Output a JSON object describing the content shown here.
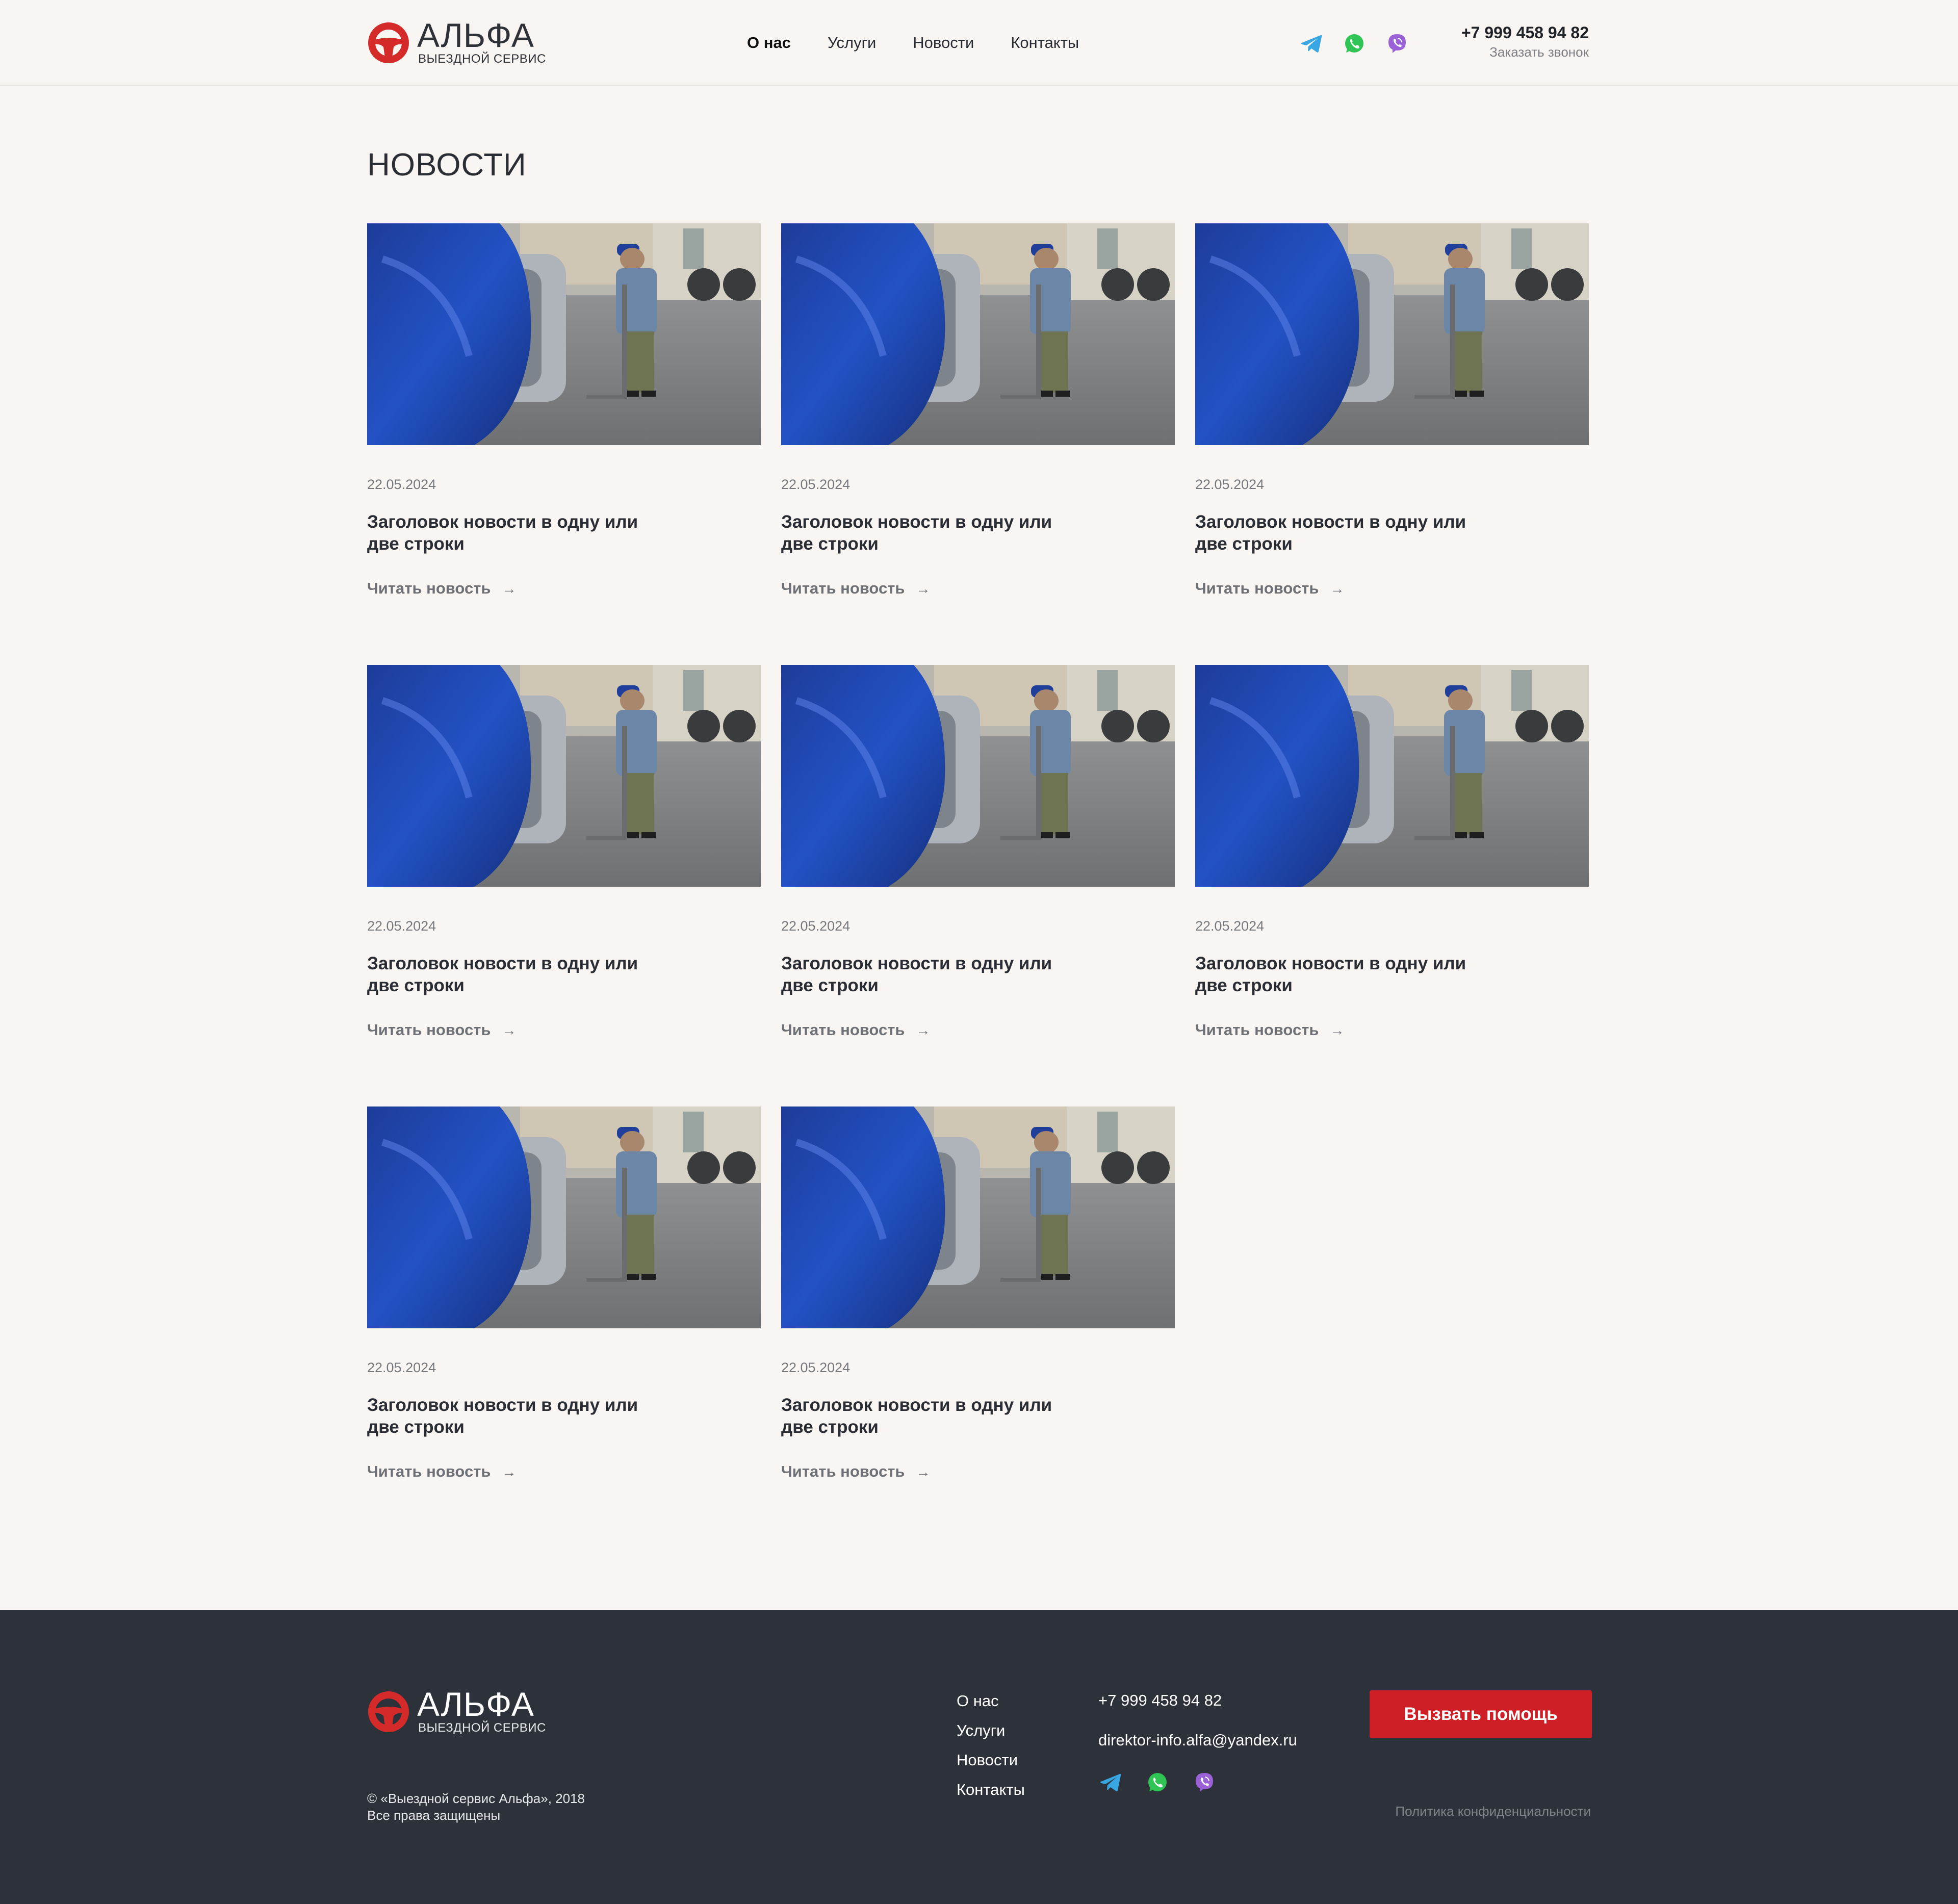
{
  "brand": {
    "name": "АЛЬФА",
    "tagline": "ВЫЕЗДНОЙ СЕРВИС",
    "color": "#d42a2a"
  },
  "nav": [
    {
      "label": "О нас",
      "active": true
    },
    {
      "label": "Услуги"
    },
    {
      "label": "Новости"
    },
    {
      "label": "Контакты"
    }
  ],
  "socials": [
    "telegram-icon",
    "whatsapp-icon",
    "viber-icon"
  ],
  "header": {
    "phone": "+7 999 458 94 82",
    "callback": "Заказать звонок"
  },
  "page": {
    "title": "НОВОСТИ"
  },
  "news": [
    {
      "date": "22.05.2024",
      "title": "Заголовок новости в одну или две строки",
      "link": "Читать новость"
    },
    {
      "date": "22.05.2024",
      "title": "Заголовок новости в одну или две строки",
      "link": "Читать новость"
    },
    {
      "date": "22.05.2024",
      "title": "Заголовок новости в одну или две строки",
      "link": "Читать новость"
    },
    {
      "date": "22.05.2024",
      "title": "Заголовок новости в одну или две строки",
      "link": "Читать новость"
    },
    {
      "date": "22.05.2024",
      "title": "Заголовок новости в одну или две строки",
      "link": "Читать новость"
    },
    {
      "date": "22.05.2024",
      "title": "Заголовок новости в одну или две строки",
      "link": "Читать новость"
    },
    {
      "date": "22.05.2024",
      "title": "Заголовок новости в одну или две строки",
      "link": "Читать новость"
    },
    {
      "date": "22.05.2024",
      "title": "Заголовок новости в одну или две строки",
      "link": "Читать новость"
    }
  ],
  "footer": {
    "nav": [
      "О нас",
      "Услуги",
      "Новости",
      "Контакты"
    ],
    "phone": "+7 999 458 94 82",
    "email": "direktor-info.alfa@yandex.ru",
    "cta": "Вызвать помощь",
    "copyright_line1": "© «Выездной сервис Альфа», 2018",
    "copyright_line2": "Все права защищены",
    "policy": "Политика конфиденциальности"
  },
  "colors": {
    "background": "#f8f5f2",
    "footer": "#2d323a",
    "accent": "#cf1f26"
  }
}
